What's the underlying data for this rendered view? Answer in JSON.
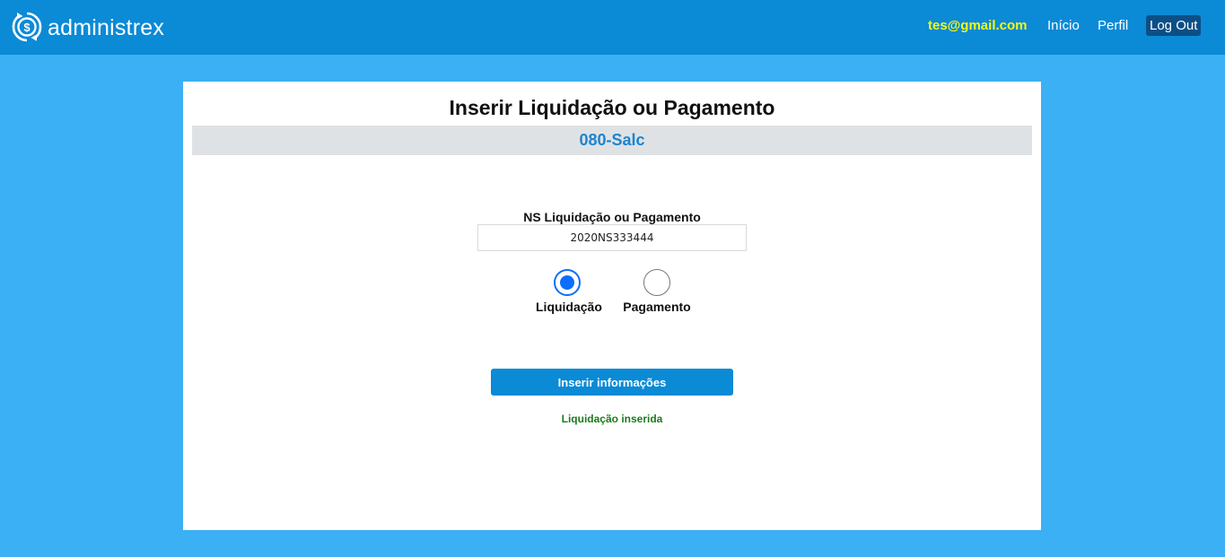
{
  "header": {
    "brand": "administrex",
    "user_email": "tes@gmail.com",
    "nav": {
      "inicio": "Início",
      "perfil": "Perfil",
      "logout": "Log Out"
    }
  },
  "main": {
    "title": "Inserir Liquidação ou Pagamento",
    "subtitle": "080-Salc",
    "ns_label": "NS Liquidação ou Pagamento",
    "ns_value": "2020NS333444",
    "radio": {
      "options": [
        "Liquidação",
        "Pagamento"
      ],
      "selected": "Liquidação"
    },
    "submit_label": "Inserir informações",
    "status_message": "Liquidação inserida"
  },
  "colors": {
    "page_background": "#3cb0f5",
    "navbar": "#0b8ad6",
    "email": "#f3f71a",
    "logout_background": "#0b4f86",
    "subtitle": "#1d84d1",
    "success": "#1d7a1d",
    "radio_selected": "#0d6efd"
  },
  "icons": {
    "brand": "dollar-coin-refresh-icon"
  }
}
